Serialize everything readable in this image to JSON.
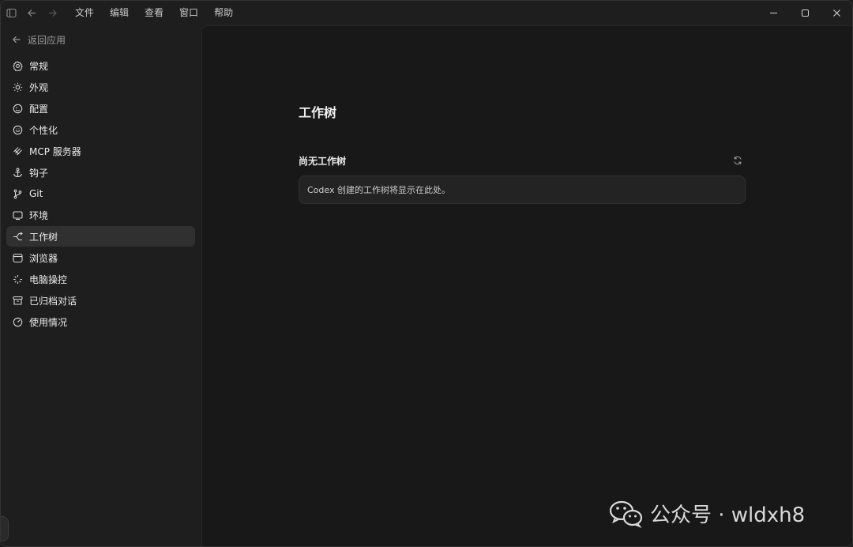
{
  "titlebar": {
    "menu": [
      "文件",
      "编辑",
      "查看",
      "窗口",
      "帮助"
    ],
    "icons": [
      "sidebar-toggle-icon",
      "back-arrow-icon",
      "forward-arrow-icon"
    ],
    "window_controls": [
      "minimize-icon",
      "maximize-icon",
      "close-icon"
    ]
  },
  "sidebar": {
    "back_label": "返回应用",
    "items": [
      {
        "label": "常规",
        "icon": "gear-icon"
      },
      {
        "label": "外观",
        "icon": "sun-icon"
      },
      {
        "label": "配置",
        "icon": "config-icon"
      },
      {
        "label": "个性化",
        "icon": "personalize-icon"
      },
      {
        "label": "MCP 服务器",
        "icon": "mcp-icon"
      },
      {
        "label": "钩子",
        "icon": "anchor-icon"
      },
      {
        "label": "Git",
        "icon": "git-branch-icon"
      },
      {
        "label": "环境",
        "icon": "monitor-icon"
      },
      {
        "label": "工作树",
        "icon": "worktree-icon",
        "active": true
      },
      {
        "label": "浏览器",
        "icon": "browser-icon"
      },
      {
        "label": "电脑操控",
        "icon": "sparkle-icon"
      },
      {
        "label": "已归档对话",
        "icon": "archive-icon"
      },
      {
        "label": "使用情况",
        "icon": "gauge-icon"
      }
    ]
  },
  "main": {
    "title": "工作树",
    "section_title": "尚无工作树",
    "empty_message": "Codex 创建的工作树将显示在此处。",
    "refresh_icon": "refresh-icon"
  },
  "watermark": {
    "text": "公众号 · wldxh8"
  },
  "colors": {
    "sidebar_bg": "#1e1e1e",
    "main_bg": "#181818",
    "active_item_bg": "#303030",
    "card_bg": "#232323"
  }
}
